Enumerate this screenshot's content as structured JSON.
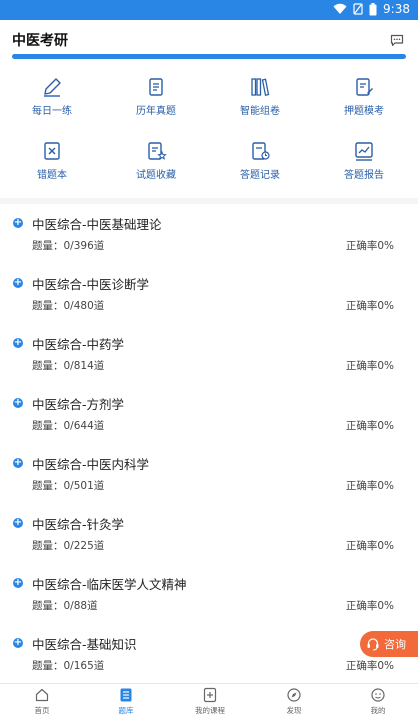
{
  "status": {
    "time": "9:38"
  },
  "header": {
    "title": "中医考研"
  },
  "grid": [
    {
      "label": "每日一练",
      "icon": "pencil-icon"
    },
    {
      "label": "历年真题",
      "icon": "scroll-icon"
    },
    {
      "label": "智能组卷",
      "icon": "books-icon"
    },
    {
      "label": "押题模考",
      "icon": "note-pen-icon"
    },
    {
      "label": "错题本",
      "icon": "wrong-box-icon"
    },
    {
      "label": "试题收藏",
      "icon": "star-doc-icon"
    },
    {
      "label": "答题记录",
      "icon": "clock-doc-icon"
    },
    {
      "label": "答题报告",
      "icon": "chart-icon"
    }
  ],
  "list": [
    {
      "title": "中医综合-中医基础理论",
      "count": "题量：0/396道",
      "rate": "正确率0%"
    },
    {
      "title": "中医综合-中医诊断学",
      "count": "题量：0/480道",
      "rate": "正确率0%"
    },
    {
      "title": "中医综合-中药学",
      "count": "题量：0/814道",
      "rate": "正确率0%"
    },
    {
      "title": "中医综合-方剂学",
      "count": "题量：0/644道",
      "rate": "正确率0%"
    },
    {
      "title": "中医综合-中医内科学",
      "count": "题量：0/501道",
      "rate": "正确率0%"
    },
    {
      "title": "中医综合-针灸学",
      "count": "题量：0/225道",
      "rate": "正确率0%"
    },
    {
      "title": "中医综合-临床医学人文精神",
      "count": "题量：0/88道",
      "rate": "正确率0%"
    },
    {
      "title": "中医综合-基础知识",
      "count": "题量：0/165道",
      "rate": "正确率0%"
    }
  ],
  "consult": {
    "label": "咨询"
  },
  "tabs": [
    {
      "label": "首页",
      "icon": "home-icon"
    },
    {
      "label": "题库",
      "icon": "question-bank-icon",
      "active": true
    },
    {
      "label": "我的课程",
      "icon": "course-icon"
    },
    {
      "label": "发现",
      "icon": "compass-icon"
    },
    {
      "label": "我的",
      "icon": "smile-icon"
    }
  ],
  "colors": {
    "primary": "#2a86e5",
    "accent": "#f26a3a"
  }
}
